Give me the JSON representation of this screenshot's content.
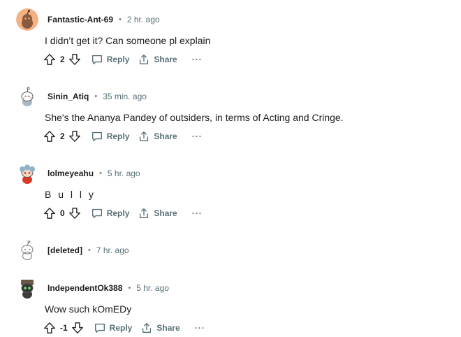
{
  "comments": [
    {
      "username": "Fantastic-Ant-69",
      "time": "2 hr. ago",
      "text": "I didn’t get it? Can someone pl explain",
      "score": "2"
    },
    {
      "username": "Sinin_Atiq",
      "time": "35 min. ago",
      "text": "She's the Ananya Pandey of outsiders, in terms of Acting and Cringe.",
      "score": "2"
    },
    {
      "username": "lolmeyeahu",
      "time": "5 hr. ago",
      "text": "B u l l y",
      "score": "0"
    },
    {
      "username": "[deleted]",
      "time": "7 hr. ago"
    },
    {
      "username": "IndependentOk388",
      "time": "5 hr. ago",
      "text": "Wow such kOmEDy",
      "score": "-1"
    }
  ],
  "actions": {
    "reply": "Reply",
    "share": "Share",
    "more": "···"
  },
  "separator": "•",
  "icons": {
    "upvote": "upvote-icon",
    "downvote": "downvote-icon",
    "reply": "comment-bubble-icon",
    "share": "share-icon",
    "more": "more-options-icon"
  },
  "colors": {
    "text": "#1c1c1c",
    "muted": "#576f76",
    "avatar_orange": "#ff4500"
  }
}
